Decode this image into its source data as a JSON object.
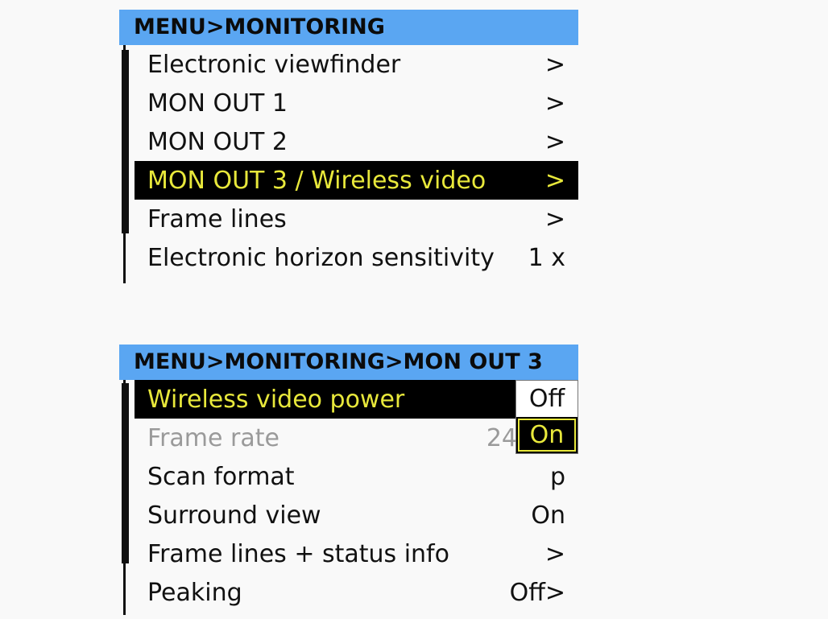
{
  "menu1": {
    "header": "MENU>MONITORING",
    "items": [
      {
        "label": "Electronic viewfinder",
        "value": ">"
      },
      {
        "label": "MON OUT 1",
        "value": ">"
      },
      {
        "label": "MON OUT 2",
        "value": ">"
      },
      {
        "label": "MON OUT 3 / Wireless video",
        "value": ">",
        "selected": true
      },
      {
        "label": "Frame lines",
        "value": ">"
      },
      {
        "label": "Electronic horizon sensitivity",
        "value": "1 x"
      }
    ]
  },
  "menu2": {
    "header": "MENU>MONITORING>MON OUT 3",
    "items": [
      {
        "label": "Wireless video power",
        "value": "",
        "selected": true
      },
      {
        "label": "Frame rate",
        "value": "24",
        "disabled": true
      },
      {
        "label": "Scan format",
        "value": "p"
      },
      {
        "label": "Surround view",
        "value": "On"
      },
      {
        "label": "Frame lines + status info",
        "value": ">"
      },
      {
        "label": "Peaking",
        "value": "Off>"
      }
    ],
    "popup": {
      "options": [
        "Off",
        "On"
      ],
      "selected": "On"
    }
  },
  "colors": {
    "header_bg": "#5aa6f2",
    "selection_bg": "#000000",
    "selection_text": "#e8e83b",
    "disabled_text": "#9a9a9a",
    "page_bg": "#f9f9f9"
  }
}
